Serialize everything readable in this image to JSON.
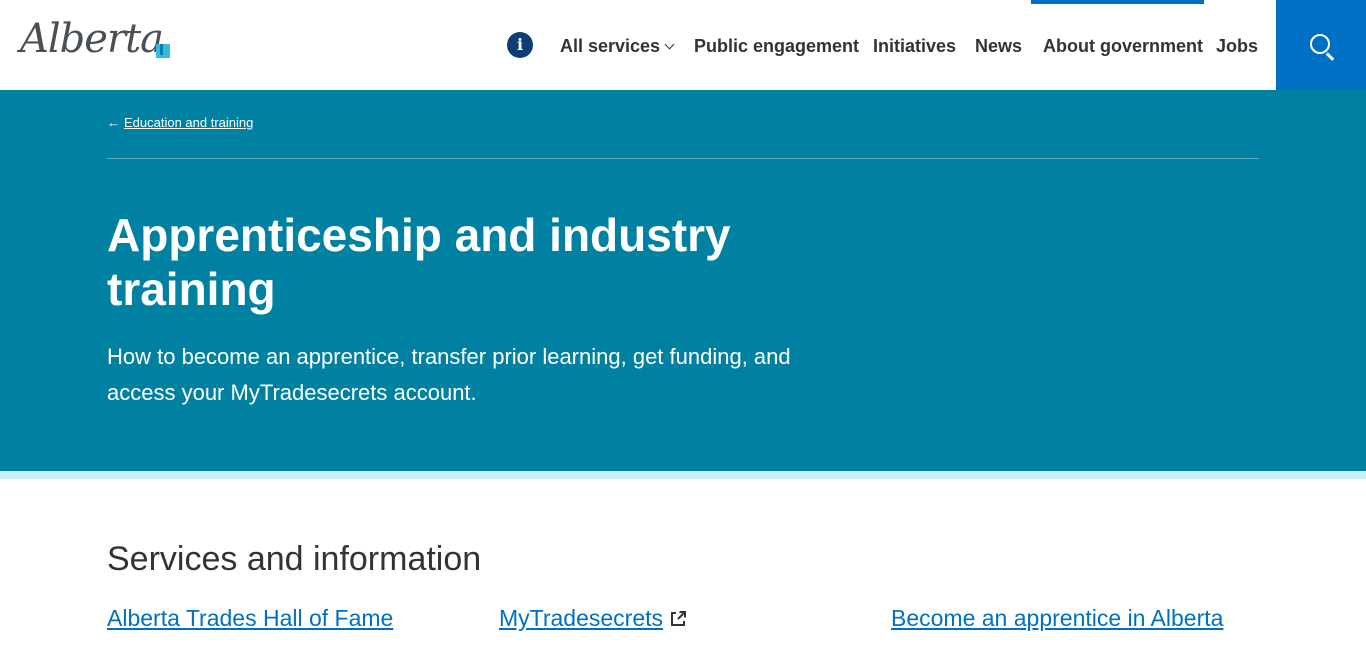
{
  "header": {
    "logo_text": "Alberta",
    "info_icon": "i",
    "nav": {
      "all_services": "All services",
      "public_engagement": "Public engagement",
      "initiatives": "Initiatives",
      "news": "News",
      "about_government": "About government",
      "jobs": "Jobs"
    },
    "search_icon": "search-icon"
  },
  "hero": {
    "breadcrumb": "Education and training",
    "title": "Apprenticeship and industry training",
    "description": "How to become an apprentice, transfer prior learning, get funding, and access your MyTradesecrets account."
  },
  "services": {
    "heading": "Services and information",
    "links": [
      {
        "label": "Alberta Trades Hall of Fame"
      },
      {
        "label": "MyTradesecrets",
        "icon": "external-link-icon"
      },
      {
        "label": "Become an apprentice in Alberta"
      }
    ]
  },
  "colors": {
    "brand_blue": "#0070c4",
    "hero_teal": "#0081a2",
    "hero_accent": "#c8eef8",
    "info_navy": "#0c3e73"
  }
}
